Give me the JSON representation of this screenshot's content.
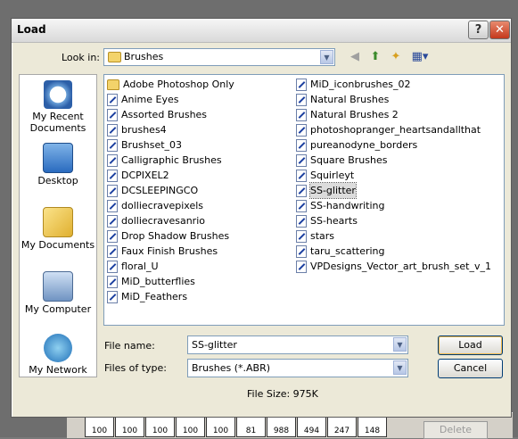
{
  "dialog": {
    "title": "Load"
  },
  "look_in": {
    "label": "Look in:",
    "value": "Brushes"
  },
  "places": [
    {
      "label": "My Recent Documents",
      "icon": "clock-document-icon"
    },
    {
      "label": "Desktop",
      "icon": "desktop-icon"
    },
    {
      "label": "My Documents",
      "icon": "folder-documents-icon"
    },
    {
      "label": "My Computer",
      "icon": "computer-icon"
    },
    {
      "label": "My Network",
      "icon": "globe-network-icon"
    }
  ],
  "files_col1": [
    {
      "name": "Adobe Photoshop Only",
      "type": "folder"
    },
    {
      "name": "Anime Eyes",
      "type": "brush"
    },
    {
      "name": "Assorted Brushes",
      "type": "brush"
    },
    {
      "name": "brushes4",
      "type": "brush"
    },
    {
      "name": "Brushset_03",
      "type": "brush"
    },
    {
      "name": "Calligraphic Brushes",
      "type": "brush"
    },
    {
      "name": "DCPIXEL2",
      "type": "brush"
    },
    {
      "name": "DCSLEEPINGCO",
      "type": "brush"
    },
    {
      "name": "dolliecravepixels",
      "type": "brush"
    },
    {
      "name": "dolliecravesanrio",
      "type": "brush"
    },
    {
      "name": "Drop Shadow Brushes",
      "type": "brush"
    },
    {
      "name": "Faux Finish Brushes",
      "type": "brush"
    },
    {
      "name": "floral_U",
      "type": "brush"
    },
    {
      "name": "MiD_butterflies",
      "type": "brush"
    },
    {
      "name": "MiD_Feathers",
      "type": "brush"
    }
  ],
  "files_col2": [
    {
      "name": "MiD_iconbrushes_02",
      "type": "brush"
    },
    {
      "name": "Natural Brushes",
      "type": "brush"
    },
    {
      "name": "Natural Brushes 2",
      "type": "brush"
    },
    {
      "name": "photoshopranger_heartsandallthat",
      "type": "brush"
    },
    {
      "name": "pureanodyne_borders",
      "type": "brush"
    },
    {
      "name": "Square Brushes",
      "type": "brush"
    },
    {
      "name": "Squirleyt",
      "type": "brush"
    },
    {
      "name": "SS-glitter",
      "type": "brush",
      "selected": true
    },
    {
      "name": "SS-handwriting",
      "type": "brush"
    },
    {
      "name": "SS-hearts",
      "type": "brush"
    },
    {
      "name": "stars",
      "type": "brush"
    },
    {
      "name": "taru_scattering",
      "type": "brush"
    },
    {
      "name": "VPDesigns_Vector_art_brush_set_v_1",
      "type": "brush"
    }
  ],
  "file_name": {
    "label": "File name:",
    "value": "SS-glitter"
  },
  "file_type": {
    "label": "Files of type:",
    "value": "Brushes (*.ABR)"
  },
  "buttons": {
    "load": "Load",
    "cancel": "Cancel"
  },
  "file_size": "File Size:  975K",
  "backdrop": {
    "thumbs": [
      "100",
      "100",
      "100",
      "100",
      "100",
      "81",
      "988",
      "494",
      "247",
      "148"
    ],
    "delete_label": "Delete"
  },
  "colors": {
    "dialog_bg": "#ece9d8",
    "close_button": "#c4381c",
    "border_blue": "#7f9db9"
  }
}
